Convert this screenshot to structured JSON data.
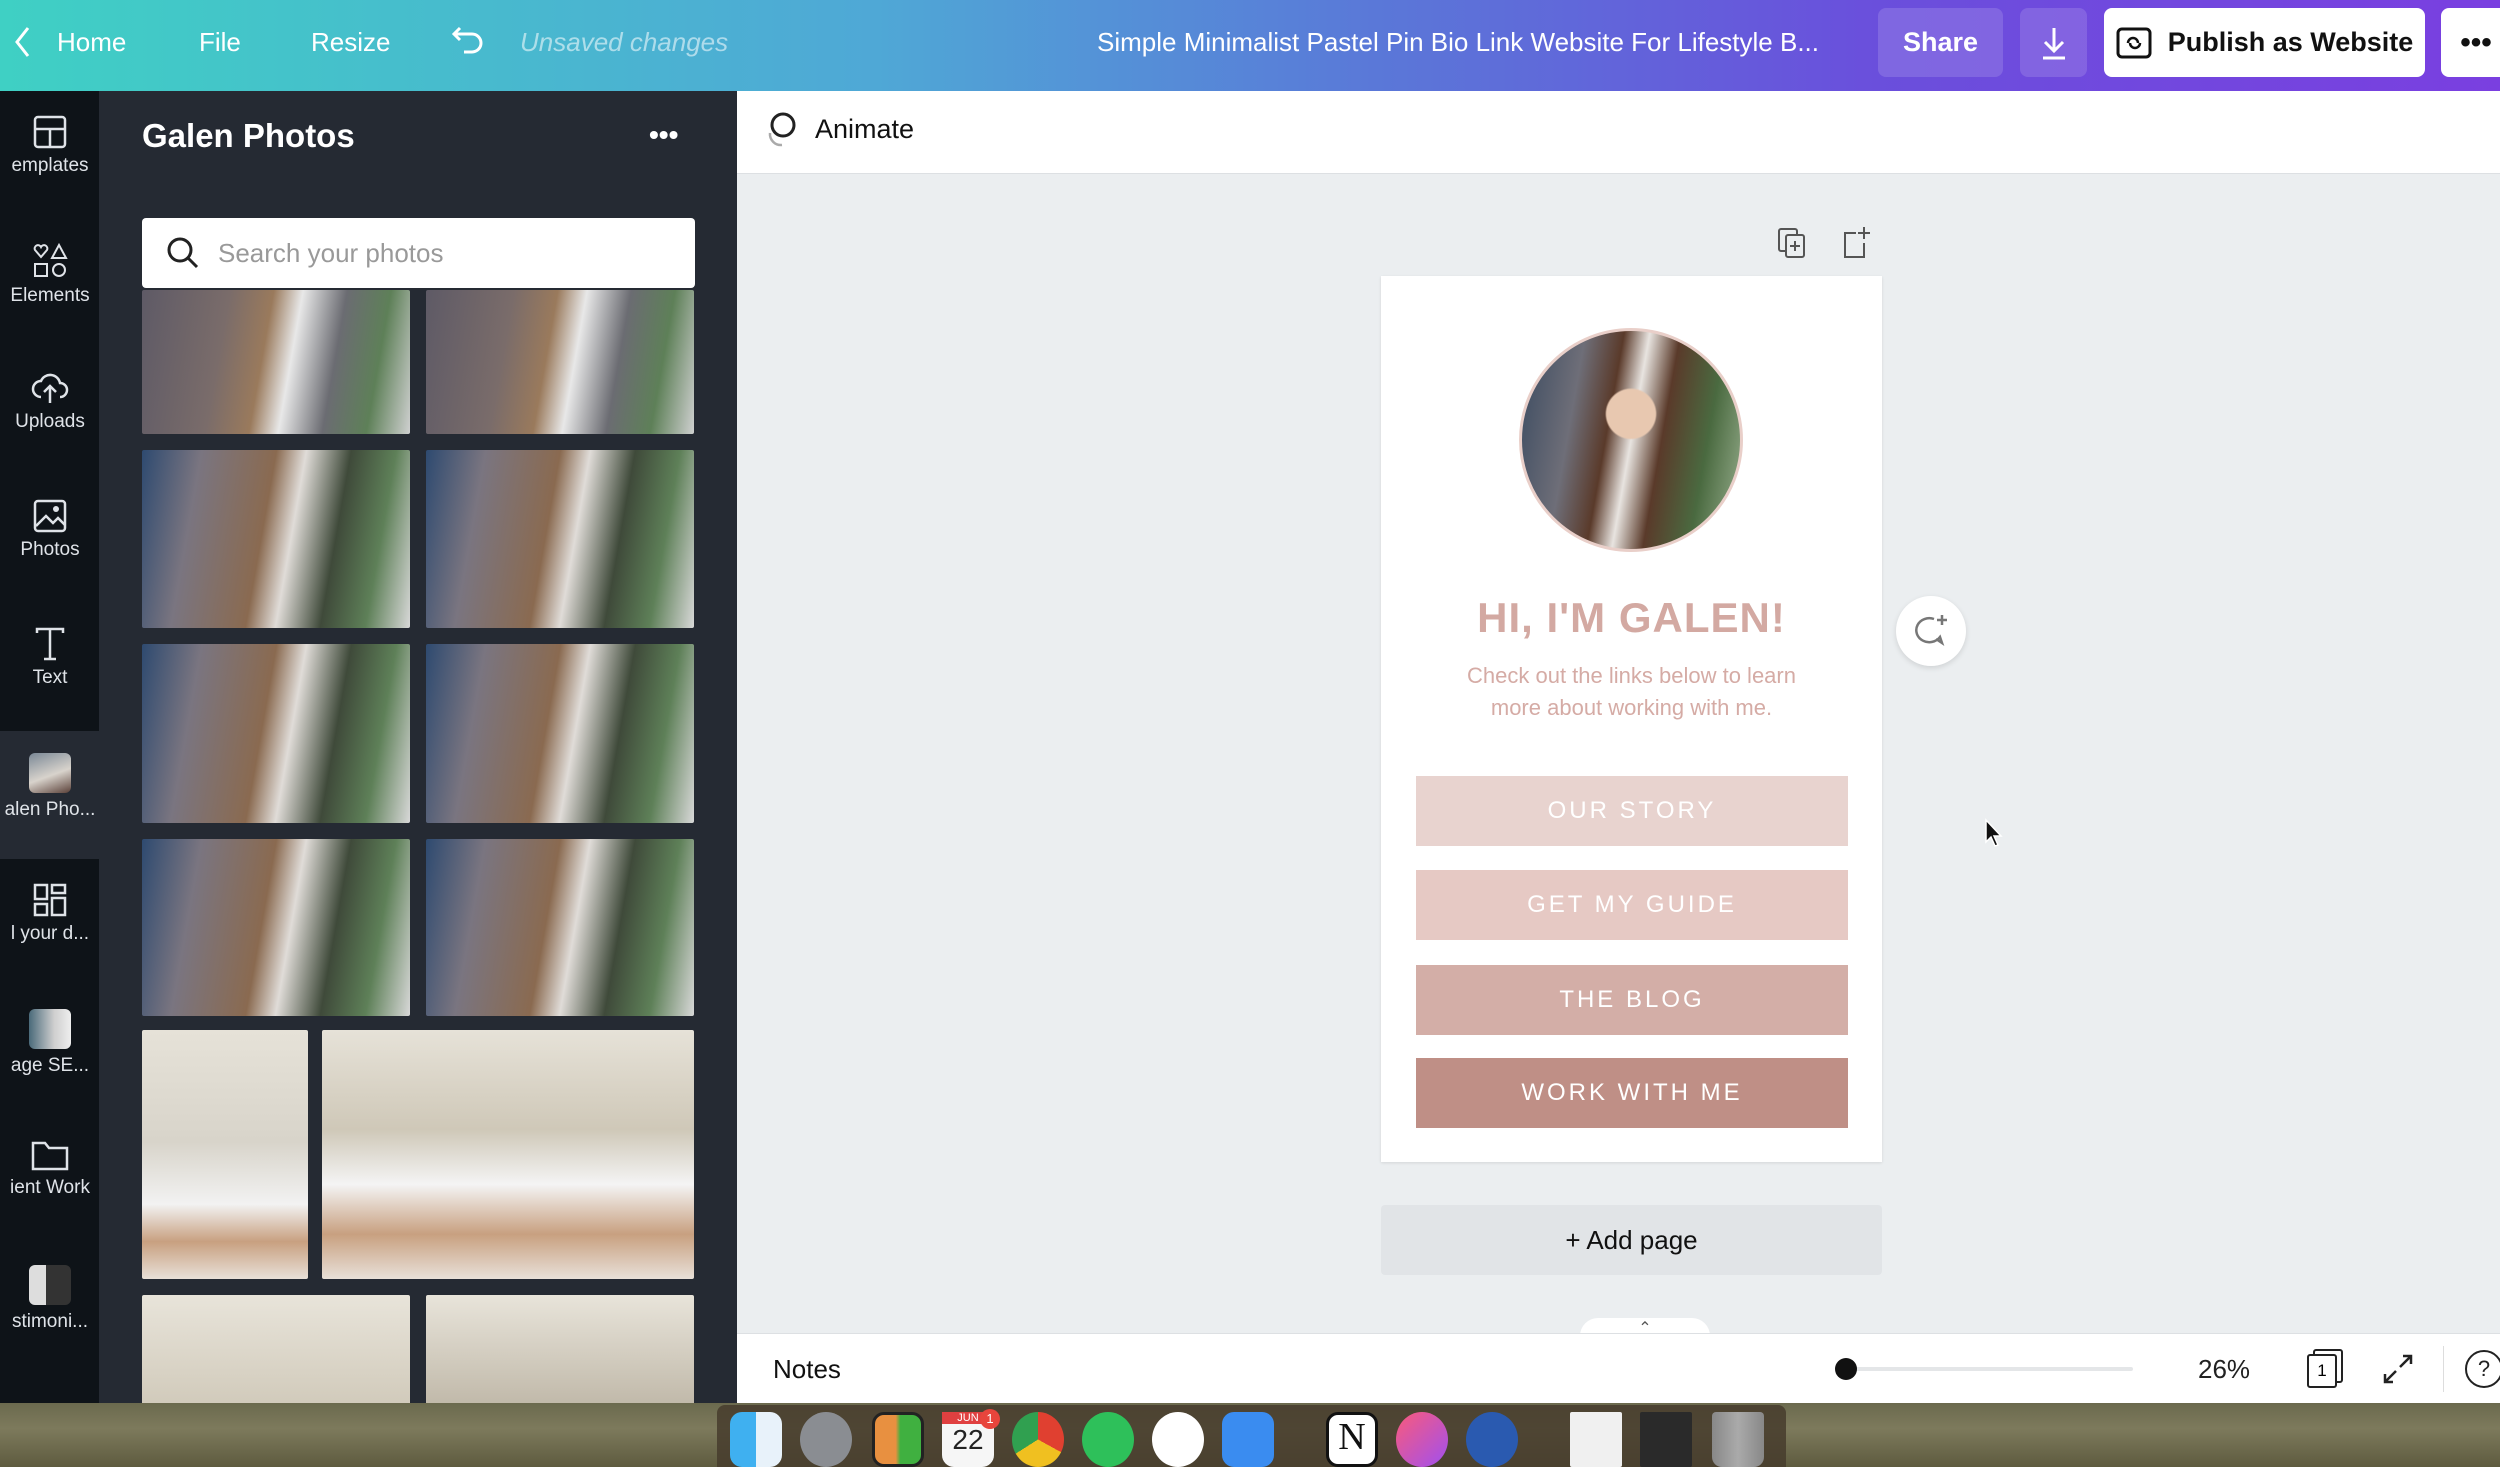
{
  "topbar": {
    "home": "Home",
    "file": "File",
    "resize": "Resize",
    "status": "Unsaved changes",
    "title": "Simple Minimalist Pastel Pin Bio Link Website For Lifestyle B...",
    "share": "Share",
    "publish": "Publish as Website"
  },
  "rail": {
    "items": [
      {
        "label": "emplates"
      },
      {
        "label": "Elements"
      },
      {
        "label": "Uploads"
      },
      {
        "label": "Photos"
      },
      {
        "label": "Text"
      },
      {
        "label": "alen Pho..."
      },
      {
        "label": "l your d..."
      },
      {
        "label": "age SE..."
      },
      {
        "label": "ient Work"
      },
      {
        "label": "stimoni..."
      }
    ]
  },
  "panel": {
    "title": "Galen Photos",
    "search_placeholder": "Search your photos"
  },
  "editor": {
    "animate": "Animate",
    "add_page": "+ Add page"
  },
  "design": {
    "heading": "HI, I'M GALEN!",
    "subtext_line1": "Check out the links below to learn",
    "subtext_line2": "more about working with me.",
    "links": [
      {
        "label": "OUR STORY",
        "color": "#e8d3cf"
      },
      {
        "label": "GET MY GUIDE",
        "color": "#e6c9c4"
      },
      {
        "label": "THE BLOG",
        "color": "#d3aea7"
      },
      {
        "label": "WORK WITH ME",
        "color": "#bf8f86"
      }
    ],
    "heading_color": "#d3a9a2"
  },
  "bottombar": {
    "notes": "Notes",
    "zoom": "26%",
    "zoom_fraction": 0.0,
    "page_count": "1"
  },
  "dock": {
    "calendar_month": "JUN",
    "calendar_day": "22",
    "calendar_badge": "1"
  }
}
